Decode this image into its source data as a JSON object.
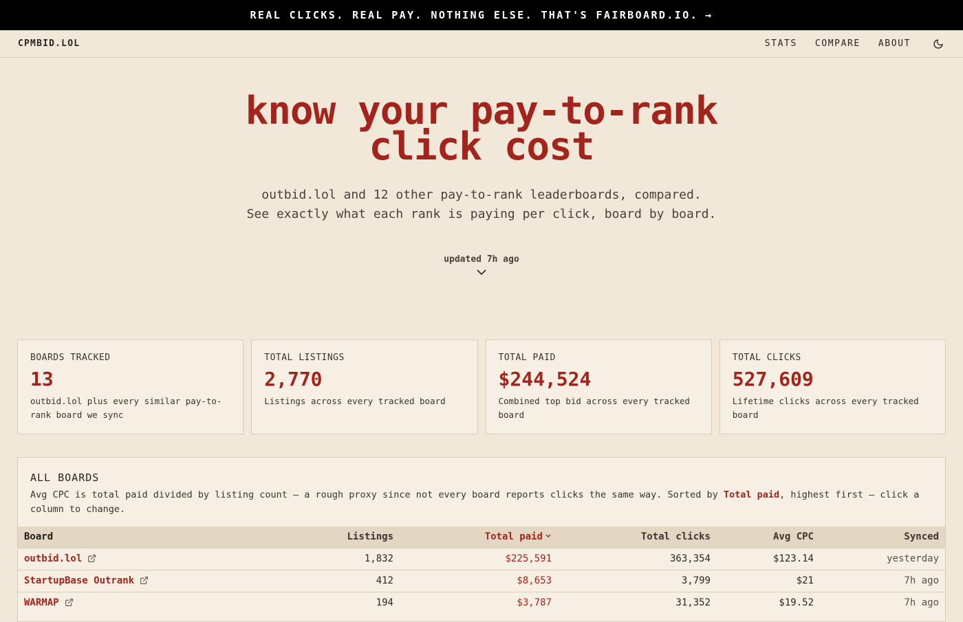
{
  "promo": {
    "text": "REAL CLICKS. REAL PAY. NOTHING ELSE. THAT'S FAIRBOARD.IO.",
    "arrow": "→"
  },
  "nav": {
    "brand": "CPMBID.LOL",
    "links": [
      "STATS",
      "COMPARE",
      "ABOUT"
    ],
    "theme_icon": "moon-icon"
  },
  "hero": {
    "title_line1": "know your pay-to-rank",
    "title_line2": "click cost",
    "sub_line1": "outbid.lol and 12 other pay-to-rank leaderboards, compared.",
    "sub_line2": "See exactly what each rank is paying per click, board by board.",
    "updated": "updated 7h ago"
  },
  "stats": [
    {
      "label": "BOARDS TRACKED",
      "value": "13",
      "desc": "outbid.lol plus every similar pay-to-rank board we sync"
    },
    {
      "label": "TOTAL LISTINGS",
      "value": "2,770",
      "desc": "Listings across every tracked board"
    },
    {
      "label": "TOTAL PAID",
      "value": "$244,524",
      "desc": "Combined top bid across every tracked board"
    },
    {
      "label": "TOTAL CLICKS",
      "value": "527,609",
      "desc": "Lifetime clicks across every tracked board"
    }
  ],
  "boards": {
    "title": "ALL BOARDS",
    "note_before": "Avg CPC is total paid divided by listing count — a rough proxy since not every board reports clicks the same way. Sorted by ",
    "note_highlight": "Total paid",
    "note_after": ", highest first — click a column to change.",
    "columns": [
      "Board",
      "Listings",
      "Total paid",
      "Total clicks",
      "Avg CPC",
      "Synced"
    ],
    "rows": [
      {
        "board": "outbid.lol",
        "listings": "1,832",
        "paid": "$225,591",
        "clicks": "363,354",
        "cpc": "$123.14",
        "synced": "yesterday"
      },
      {
        "board": "StartupBase Outrank",
        "listings": "412",
        "paid": "$8,653",
        "clicks": "3,799",
        "cpc": "$21",
        "synced": "7h ago"
      },
      {
        "board": "WARMAP",
        "listings": "194",
        "paid": "$3,787",
        "clicks": "31,352",
        "cpc": "$19.52",
        "synced": "7h ago"
      }
    ]
  },
  "colors": {
    "accent": "#a3241c",
    "background": "#f1e8d9",
    "card": "#f7efe3"
  }
}
